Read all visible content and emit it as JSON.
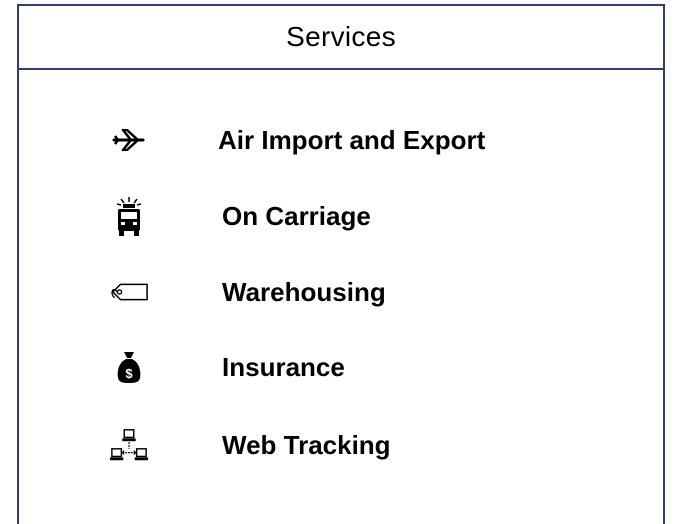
{
  "header": {
    "title": "Services"
  },
  "services": [
    {
      "label": "Air Import and Export",
      "icon": "airplane-icon"
    },
    {
      "label": "On Carriage",
      "icon": "truck-icon"
    },
    {
      "label": "Warehousing",
      "icon": "tag-icon"
    },
    {
      "label": "Insurance",
      "icon": "money-bag-icon"
    },
    {
      "label": "Web Tracking",
      "icon": "network-icon"
    }
  ],
  "colors": {
    "border": "#2f3f6e",
    "text": "#000000",
    "background": "#ffffff"
  }
}
